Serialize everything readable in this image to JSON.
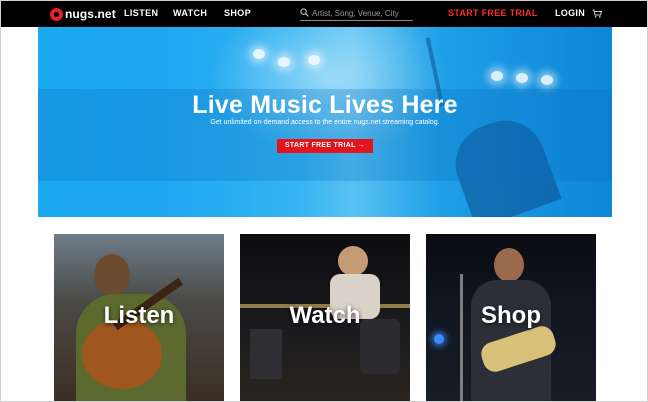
{
  "header": {
    "logo_text": "nugs.net",
    "nav": [
      {
        "label": "LISTEN"
      },
      {
        "label": "WATCH"
      },
      {
        "label": "SHOP"
      }
    ],
    "search": {
      "placeholder": "Artist, Song, Venue, City",
      "icon": "search-icon"
    },
    "trial_label": "START FREE TRIAL",
    "login_label": "LOGIN",
    "cart_icon": "cart-icon"
  },
  "hero": {
    "title": "Live Music Lives Here",
    "subtitle": "Get unlimited on-demand access to the entire nugs.net streaming catalog.",
    "cta_label": "START FREE TRIAL →"
  },
  "cards": [
    {
      "label": "Listen"
    },
    {
      "label": "Watch"
    },
    {
      "label": "Shop"
    }
  ],
  "colors": {
    "nav_bg": "#000000",
    "accent_red": "#e3141c",
    "hero_blue": "#1aa8ef"
  }
}
